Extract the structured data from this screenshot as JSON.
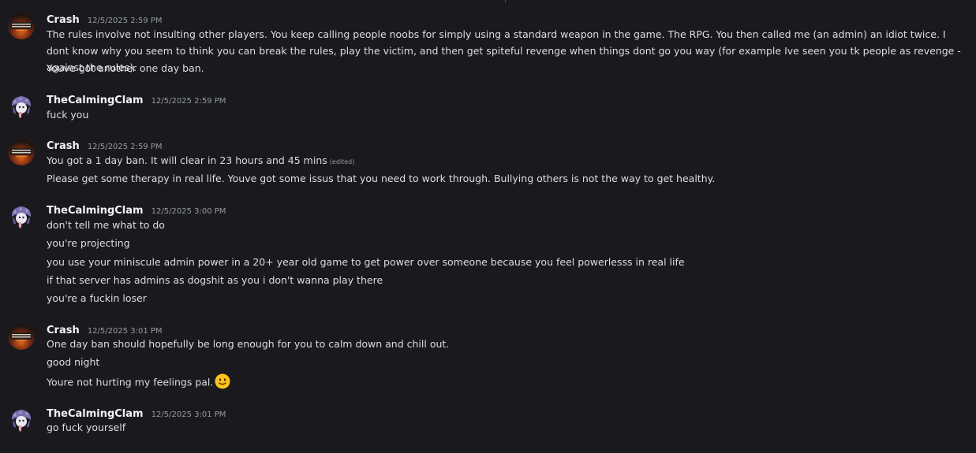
{
  "messages": [
    {
      "author": "Crash",
      "timestamp": "12/5/2025 2:59 PM",
      "avatar": "battlefield-logo-avatar",
      "lines": [
        "The rules involve not insulting other players. You keep calling people noobs for simply using a standard weapon in the game. The RPG. You then called me (an admin) an idiot twice. I dont know why you seem to think you can break the rules, play the victim, and then get spiteful revenge when things dont go you way (for example Ive seen you tk people as revenge -against the rules).",
        "Youve got another one day ban."
      ]
    },
    {
      "author": "TheCalmingClam",
      "timestamp": "12/5/2025 2:59 PM",
      "avatar": "clam-creature-avatar",
      "lines": [
        "fuck you"
      ]
    },
    {
      "author": "Crash",
      "timestamp": "12/5/2025 2:59 PM",
      "avatar": "battlefield-logo-avatar",
      "lines": [
        "You got a 1 day ban. It will clear in 23 hours and 45 mins",
        "Please get some therapy in real life. Youve got some issus that  you need to work through. Bullying others is not the way to get healthy."
      ],
      "edited_label": "(edited)"
    },
    {
      "author": "TheCalmingClam",
      "timestamp": "12/5/2025 3:00 PM",
      "avatar": "clam-creature-avatar",
      "lines": [
        "don't tell me what to do",
        "you're projecting",
        "you use your miniscule admin power in a 20+ year old game to get power over someone because you feel powerlesss in real life",
        "if that server has admins as dogshit as you i don't wanna play there",
        "you're a fuckin loser"
      ]
    },
    {
      "author": "Crash",
      "timestamp": "12/5/2025 3:01 PM",
      "avatar": "battlefield-logo-avatar",
      "lines": [
        "One day ban should hopefully be long enough for you to calm down and chill out.",
        "good night",
        "Youre not hurting my feelings pal."
      ],
      "emoji": "slightly-smiling-face-emoji"
    },
    {
      "author": "TheCalmingClam",
      "timestamp": "12/5/2025 3:01 PM",
      "avatar": "clam-creature-avatar",
      "lines": [
        "go fuck yourself"
      ]
    }
  ],
  "colors": {
    "background": "#1a1a1e",
    "username": "#f2f3f5",
    "text": "#dbdee1",
    "timestamp": "#949ba4"
  }
}
